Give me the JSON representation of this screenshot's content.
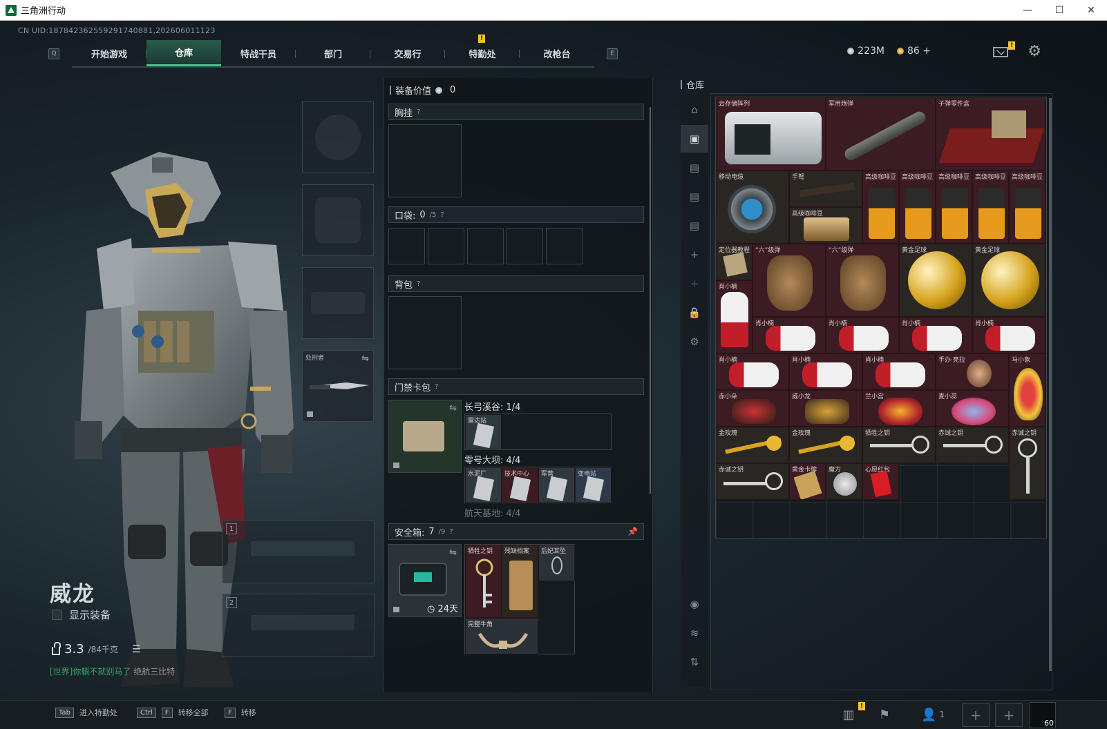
{
  "window": {
    "title": "三角洲行动",
    "minimize": "—",
    "maximize": "☐",
    "close": "✕"
  },
  "uid": "CN UID:18784236255929174​0881,202606011123",
  "nav": {
    "left_key": "Q",
    "right_key": "E",
    "tabs": [
      "开始游戏",
      "仓库",
      "特战干员",
      "部门",
      "交易行",
      "特勤处",
      "改枪台"
    ],
    "active_tab": "仓库",
    "badge": "!"
  },
  "currency": {
    "silver": "223M",
    "gold": "86",
    "plus": "+"
  },
  "mail_badge": "!",
  "character": {
    "name": "威龙",
    "show_equipment_label": "显示装备",
    "weight_value": "3.3",
    "weight_capacity": "/84千克",
    "chat": {
      "channel": "[世界]",
      "message": "你躺不就别马了",
      "sender": "绝航三比特"
    }
  },
  "equip_slots": {
    "knife_label": "处刑者",
    "weapon_slot_1": "1",
    "weapon_slot_2": "2"
  },
  "loadout": {
    "value_label": "装备价值",
    "value": "0",
    "chest_rig": "胸挂",
    "pocket_label": "口袋:",
    "pocket_count": "0",
    "pocket_cap": "/5",
    "backpack": "背包",
    "keycard": "门禁卡包",
    "map1": "长弓溪谷: 1/4",
    "map1_item": "雷达站",
    "map2": "零号大坝: 4/4",
    "map2_items": [
      "水泥厂",
      "技术中心",
      "军营",
      "变电站"
    ],
    "map3": "航天基地: 4/4",
    "safebox_label": "安全箱:",
    "safebox_count": "7",
    "safebox_cap": "/9",
    "safebox_time": "24天",
    "safe_items": [
      "牺牲之钥",
      "残缺档案",
      "后妃耳坠",
      "完整牛角"
    ],
    "help": "?"
  },
  "warehouse": {
    "title": "仓库",
    "items": [
      "云存储阵列",
      "军用炮弹",
      "子弹零件盒",
      "移动电缆",
      "手弩",
      "高级咖啡豆",
      "高级咖啡豆",
      "高级咖啡豆",
      "高级咖啡豆",
      "高级咖啡豆",
      "定位器教程",
      "“六”级弹",
      "“六”级弹",
      "黄金足球",
      "黄金足球",
      "肖小楠",
      "肖小楠",
      "肖小楠",
      "肖小楠",
      "肖小楠",
      "肖小楠",
      "肖小楠",
      "肖小楠",
      "手办·亮拉",
      "马小象",
      "赤小朵",
      "威小龙",
      "兰小宫",
      "麦小蕊",
      "金玫瑰",
      "金玫瑰",
      "牺牲之钥",
      "赤诚之钥",
      "赤诚之钥",
      "赤诚之钥",
      "黄金卡牌",
      "魔方",
      "心愿红包"
    ]
  },
  "bottom": {
    "hints": [
      {
        "keys": [
          "Tab"
        ],
        "label": "进入特勤处"
      },
      {
        "keys": [
          "Ctrl",
          "F"
        ],
        "label": "转移全部"
      },
      {
        "keys": [
          "F"
        ],
        "label": "转移"
      }
    ],
    "friends_count": "1",
    "level": "60",
    "badge": "!"
  }
}
